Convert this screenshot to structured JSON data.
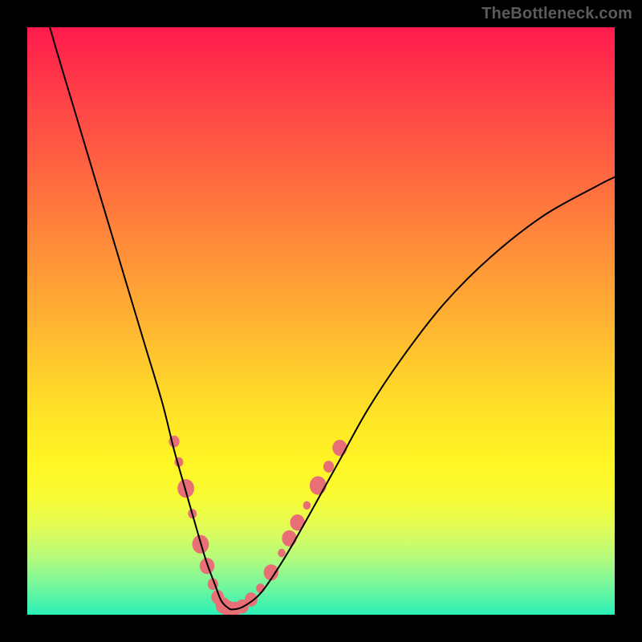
{
  "watermark": "TheBottleneck.com",
  "chart_data": {
    "type": "line",
    "title": "",
    "xlabel": "",
    "ylabel": "",
    "xlim": [
      0,
      100
    ],
    "ylim": [
      0,
      100
    ],
    "grid": false,
    "legend": false,
    "series": [
      {
        "name": "bottleneck-curve",
        "color": "#000000",
        "x": [
          3,
          5,
          8,
          11,
          14,
          17,
          20,
          23,
          25,
          27,
          29,
          30.5,
          32,
          33,
          34,
          35,
          37,
          40,
          44,
          48,
          53,
          58,
          64,
          71,
          79,
          88,
          97,
          100
        ],
        "y": [
          103,
          96,
          86,
          76,
          66,
          56,
          46,
          36,
          28,
          21,
          14,
          9,
          5,
          2.4,
          1.3,
          0.9,
          1.5,
          4,
          10,
          17,
          26,
          35,
          44,
          53,
          61,
          68,
          73,
          74.5
        ]
      }
    ],
    "markers": {
      "color": "#e96f77",
      "radius_range": [
        5,
        11
      ],
      "points": [
        {
          "x": 25.0,
          "y": 29.5,
          "w": 1.0
        },
        {
          "x": 25.8,
          "y": 26.0,
          "w": 0.9
        },
        {
          "x": 27.0,
          "y": 21.5,
          "w": 1.3
        },
        {
          "x": 28.1,
          "y": 17.2,
          "w": 0.9
        },
        {
          "x": 29.5,
          "y": 12.0,
          "w": 1.3
        },
        {
          "x": 30.6,
          "y": 8.3,
          "w": 1.2
        },
        {
          "x": 31.6,
          "y": 5.2,
          "w": 1.0
        },
        {
          "x": 32.4,
          "y": 3.0,
          "w": 1.1
        },
        {
          "x": 33.3,
          "y": 1.6,
          "w": 1.2
        },
        {
          "x": 34.3,
          "y": 1.0,
          "w": 1.2
        },
        {
          "x": 35.4,
          "y": 1.0,
          "w": 1.1
        },
        {
          "x": 36.6,
          "y": 1.4,
          "w": 1.1
        },
        {
          "x": 38.1,
          "y": 2.6,
          "w": 1.1
        },
        {
          "x": 39.7,
          "y": 4.5,
          "w": 0.9
        },
        {
          "x": 41.5,
          "y": 7.2,
          "w": 1.2
        },
        {
          "x": 43.3,
          "y": 10.5,
          "w": 0.85
        },
        {
          "x": 44.6,
          "y": 13.0,
          "w": 1.2
        },
        {
          "x": 46.0,
          "y": 15.7,
          "w": 1.2
        },
        {
          "x": 47.6,
          "y": 18.6,
          "w": 0.85
        },
        {
          "x": 49.5,
          "y": 22.0,
          "w": 1.3
        },
        {
          "x": 51.3,
          "y": 25.2,
          "w": 1.0
        },
        {
          "x": 53.2,
          "y": 28.4,
          "w": 1.2
        }
      ]
    },
    "gradient_colors": {
      "top": "#ff1a4d",
      "upper_mid": "#ff8f39",
      "mid": "#ffe826",
      "lower_mid": "#b8fb7a",
      "bottom": "#2af0b5"
    }
  }
}
